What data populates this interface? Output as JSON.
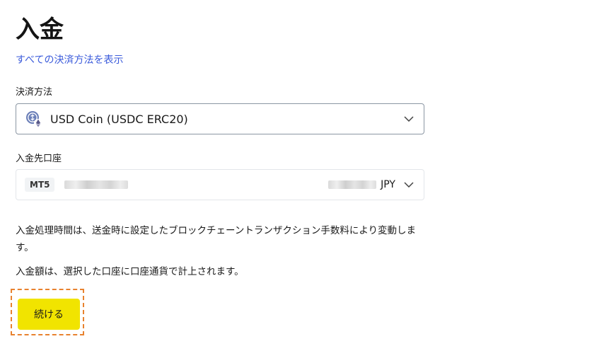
{
  "page": {
    "title": "入金",
    "all_methods_link": "すべての決済方法を表示"
  },
  "payment_method": {
    "label": "決済方法",
    "selected": "USD Coin (USDC ERC20)",
    "icon": "usdc-coin-icon"
  },
  "deposit_account": {
    "label": "入金先口座",
    "platform_tag": "MT5",
    "currency": "JPY"
  },
  "info": {
    "processing_time": "入金処理時間は、送金時に設定したブロックチェーントランザクション手数料により変動します。",
    "credit_note": "入金額は、選択した口座に口座通貨で計上されます。"
  },
  "actions": {
    "continue_label": "続ける"
  },
  "colors": {
    "link": "#3b5bdb",
    "primary_button": "#f1e400",
    "highlight_outline": "#e8822f"
  }
}
